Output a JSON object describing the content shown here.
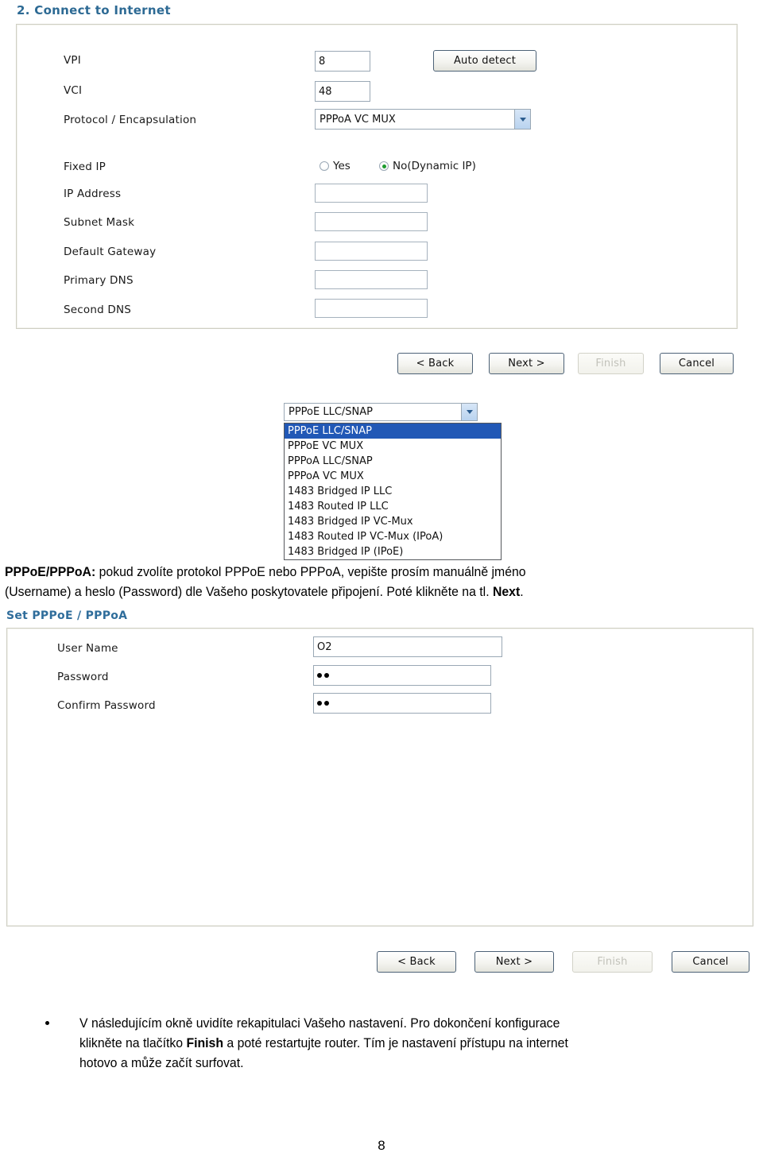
{
  "document": {
    "page_number": "8"
  },
  "section_internet": {
    "title": "2. Connect to Internet",
    "fields": [
      {
        "label": "VPI",
        "value": "8"
      },
      {
        "label": "VCI",
        "value": "48"
      }
    ],
    "protocol": {
      "label": "Protocol / Encapsulation",
      "value": "PPPoA VC MUX"
    },
    "auto_detect_label": "Auto detect",
    "fixed_ip": {
      "label": "Fixed IP",
      "options": [
        {
          "label": "Yes",
          "checked": false
        },
        {
          "label": "No(Dynamic IP)",
          "checked": true
        }
      ]
    },
    "ip_fields": [
      {
        "label": "IP Address",
        "value": ""
      },
      {
        "label": "Subnet Mask",
        "value": ""
      },
      {
        "label": "Default Gateway",
        "value": ""
      },
      {
        "label": "Primary DNS",
        "value": ""
      },
      {
        "label": "Second DNS",
        "value": ""
      }
    ],
    "buttons": [
      {
        "label": "< Back",
        "disabled": false
      },
      {
        "label": "Next >",
        "disabled": false
      },
      {
        "label": "Finish",
        "disabled": true
      },
      {
        "label": "Cancel",
        "disabled": false
      }
    ]
  },
  "protocol_dropdown": {
    "selected_value": "PPPoE LLC/SNAP",
    "options": [
      "PPPoE LLC/SNAP",
      "PPPoE VC MUX",
      "PPPoA LLC/SNAP",
      "PPPoA VC MUX",
      "1483 Bridged IP LLC",
      "1483 Routed IP LLC",
      "1483 Bridged IP VC-Mux",
      "1483 Routed IP VC-Mux (IPoA)",
      "1483 Bridged IP (IPoE)"
    ],
    "selected_index": 0
  },
  "paragraph_pppoe": {
    "lead": "PPPoE/PPPoA:",
    "line1_rest": " pokud zvolíte protokol PPPoE nebo PPPoA, vepište prosím manuálně jméno",
    "line2_before": "(Username) a heslo (Password) dle Vašeho poskytovatele připojení. Poté klikněte na tl. ",
    "line2_bold": "Next",
    "line2_after": "."
  },
  "section_pppoe": {
    "title": "Set PPPoE / PPPoA",
    "fields": [
      {
        "label": "User Name",
        "value": "O2",
        "type": "text"
      },
      {
        "label": "Password",
        "value": "••",
        "type": "password",
        "dots": 2
      },
      {
        "label": "Confirm Password",
        "value": "••",
        "type": "password",
        "dots": 2
      }
    ],
    "buttons": [
      {
        "label": "< Back",
        "disabled": false
      },
      {
        "label": "Next >",
        "disabled": false
      },
      {
        "label": "Finish",
        "disabled": true
      },
      {
        "label": "Cancel",
        "disabled": false
      }
    ]
  },
  "bullet_finish": {
    "line1": "V následujícím okně uvidíte rekapitulaci Vašeho nastavení. Pro dokončení konfigurace",
    "line2_before": "klikněte na tlačítko ",
    "line2_bold": "Finish",
    "line2_after": " a poté restartujte router. Tím je nastavení přístupu na internet",
    "line3": "hotovo a může začít surfovat."
  },
  "colors": {
    "heading_blue": "#2d6a94",
    "panel_border": "#cfcfc4",
    "select_highlight": "#2158b6",
    "radio_dot_green": "#1d9b2e"
  }
}
